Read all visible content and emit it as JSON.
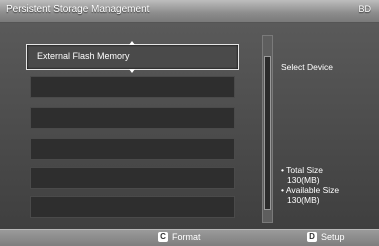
{
  "header": {
    "title": "Persistent Storage Management",
    "brand": "BD"
  },
  "list": {
    "selected_label": "External Flash Memory"
  },
  "right_panel": {
    "select_device": "Select Device",
    "total_size_label": "• Total Size",
    "total_size_value": "130(MB)",
    "available_size_label": "• Available Size",
    "available_size_value": "130(MB)"
  },
  "footer": {
    "format_key": "C",
    "format_label": "Format",
    "setup_key": "D",
    "setup_label": "Setup"
  }
}
